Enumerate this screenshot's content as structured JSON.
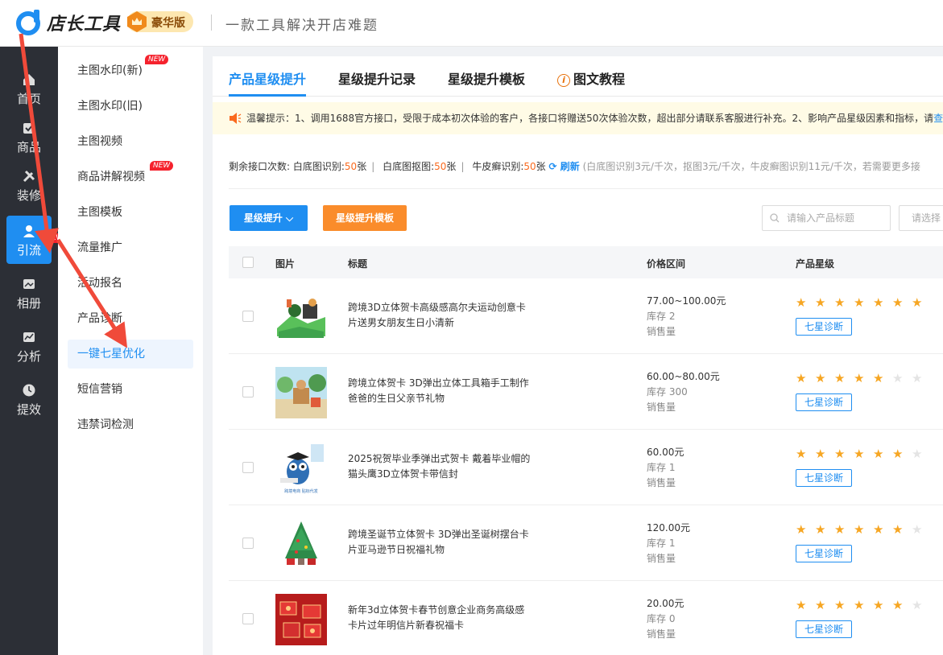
{
  "app": {
    "name": "店长工具",
    "badge": "豪华版",
    "slogan": "一款工具解决开店难题"
  },
  "rail": {
    "items": [
      {
        "label": "首页",
        "icon": "home-icon"
      },
      {
        "label": "商品",
        "icon": "goods-icon"
      },
      {
        "label": "装修",
        "icon": "decorate-icon"
      },
      {
        "label": "引流",
        "icon": "traffic-icon",
        "active": true
      },
      {
        "label": "相册",
        "icon": "album-icon"
      },
      {
        "label": "分析",
        "icon": "analysis-icon"
      },
      {
        "label": "提效",
        "icon": "efficiency-icon"
      }
    ],
    "new_tag": "NEW"
  },
  "submenu": {
    "items": [
      {
        "label": "主图水印(新)",
        "new": true
      },
      {
        "label": "主图水印(旧)"
      },
      {
        "label": "主图视频"
      },
      {
        "label": "商品讲解视频",
        "new": true
      },
      {
        "label": "主图模板"
      },
      {
        "label": "流量推广"
      },
      {
        "label": "活动报名"
      },
      {
        "label": "产品诊断"
      },
      {
        "label": "一键七星优化",
        "active": true
      },
      {
        "label": "短信营销"
      },
      {
        "label": "违禁词检测"
      }
    ],
    "new_tag": "NEW"
  },
  "tabs": [
    {
      "label": "产品星级提升",
      "active": true
    },
    {
      "label": "星级提升记录"
    },
    {
      "label": "星级提升模板"
    },
    {
      "label": "图文教程",
      "icon": "info-icon"
    }
  ],
  "notice": {
    "text": "温馨提示：1、调用1688官方接口，受限于成本初次体验的客户，各接口将赠送50次体验次数，超出部分请联系客服进行补充。2、影响产品星级因素和指标，请",
    "link": "查看"
  },
  "quota": {
    "label": "剩余接口次数:",
    "white_bg_recognize_label": "白底图识别:",
    "white_bg_recognize_value": "50",
    "white_bg_cutout_label": "白底图抠图:",
    "white_bg_cutout_value": "50",
    "psoriasis_label": "牛皮癣识别:",
    "psoriasis_value": "50",
    "unit": "张",
    "refresh_label": "刷新",
    "hint": "(白底图识别3元/千次，抠图3元/千次，牛皮癣图识别11元/千次，若需要更多接"
  },
  "toolbar": {
    "star_boost_label": "星级提升",
    "star_template_label": "星级提升模板",
    "search_placeholder": "请输入产品标题",
    "select_placeholder": "请选择"
  },
  "table": {
    "headers": {
      "image": "图片",
      "title": "标题",
      "price": "价格区间",
      "stars": "产品星级"
    },
    "diagnose_label": "七星诊断",
    "stock_prefix": "库存",
    "sales_label": "销售量",
    "rows": [
      {
        "title": "跨境3D立体贺卡高级感高尔夫运动创意卡片送男女朋友生日小清新",
        "price": "77.00~100.00元",
        "stock": "2",
        "stars": 7
      },
      {
        "title": "跨境立体贺卡 3D弹出立体工具箱手工制作爸爸的生日父亲节礼物",
        "price": "60.00~80.00元",
        "stock": "300",
        "stars": 5
      },
      {
        "title": "2025祝贺毕业季弹出式贺卡 戴着毕业帽的猫头鹰3D立体贺卡带信封",
        "price": "60.00元",
        "stock": "1",
        "stars": 6,
        "thumb_text": "跨境电商  贴标代发"
      },
      {
        "title": "跨境圣诞节立体贺卡 3D弹出圣诞树摆台卡片亚马逊节日祝福礼物",
        "price": "120.00元",
        "stock": "1",
        "stars": 6
      },
      {
        "title": "新年3d立体贺卡春节创意企业商务高级感卡片过年明信片新春祝福卡",
        "price": "20.00元",
        "stock": "0",
        "stars": 6
      }
    ]
  },
  "colors": {
    "primary": "#1f8ef1",
    "orange": "#fa8c2b",
    "rail_bg": "#2c2f36",
    "new_red": "#f5222d",
    "star": "#f6a623",
    "arrow": "#f04a3a"
  }
}
